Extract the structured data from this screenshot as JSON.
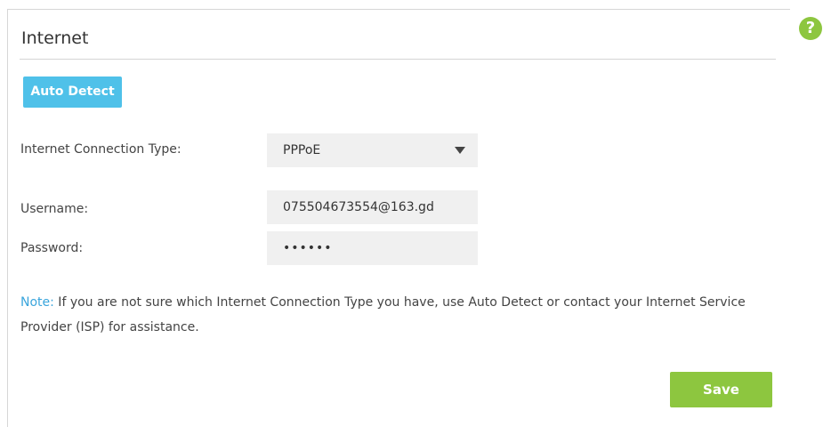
{
  "section": {
    "title": "Internet",
    "help_icon": "question-mark-icon",
    "help_glyph": "?"
  },
  "auto_detect": {
    "label": "Auto Detect"
  },
  "connection_type": {
    "label": "Internet Connection Type:",
    "value": "PPPoE",
    "icon": "caret-down-icon"
  },
  "username": {
    "label": "Username:",
    "value": "075504673554@163.gd"
  },
  "password": {
    "label": "Password:",
    "value": "••••••"
  },
  "note": {
    "label": "Note:",
    "text": " If you are not sure which Internet Connection Type you have, use Auto Detect or contact your Internet Service Provider (ISP) for assistance."
  },
  "save": {
    "label": "Save"
  },
  "colors": {
    "accent_blue": "#4fc1e9",
    "accent_green": "#8dc63f",
    "note_blue": "#3aa5dc"
  }
}
